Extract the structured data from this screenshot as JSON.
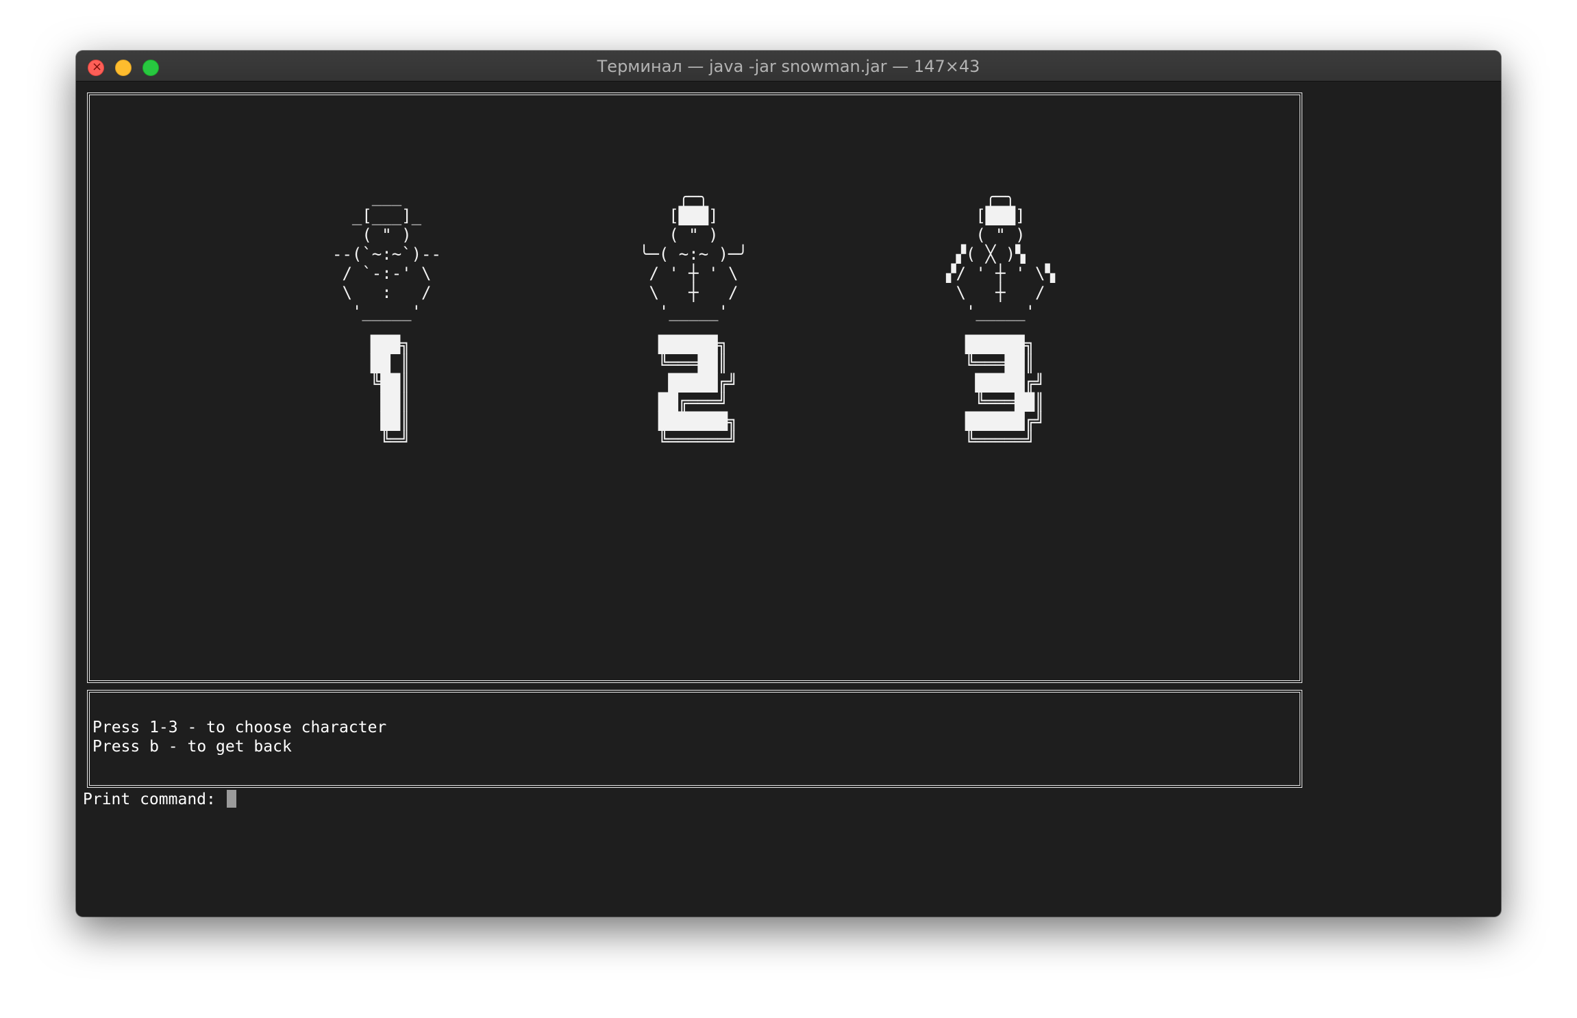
{
  "window": {
    "title": "Терминал — java -jar snowman.jar — 147×43"
  },
  "characters": [
    {
      "art": "    ___\n  _[___]_\n   ( \" )\n--(`~:~`)--\n / `-:-' \\\n \\   :   /\n  '_____'",
      "number_art": "███╗\n██ ║\n╚██║\n ██║\n ██║\n ╚═╝"
    },
    {
      "art": "    ╭─╮\n   [███]\n   ( \" )\n╰─( ~:~ )─╯\n / ' ┼ ' \\\n \\   ┼   /\n  '_____'",
      "number_art": "██████╗\n╚═══██║\n █████╔╝\n██╔═══╝\n███████╗\n╚══════╝"
    },
    {
      "art": "    ╭─╮\n   [███]\n   ( \" )\n ▞( ╳ )▚\n▞/ ' ┼ ' \\▚\n \\   ┼   /\n  '_____'",
      "number_art": "██████╗\n╚═══██║\n █████╔╝\n ╚═══██║\n██████╔╝\n╚═════╝"
    }
  ],
  "hints": [
    "Press 1-3 - to choose character",
    "Press b - to get back"
  ],
  "prompt": "Print command: "
}
